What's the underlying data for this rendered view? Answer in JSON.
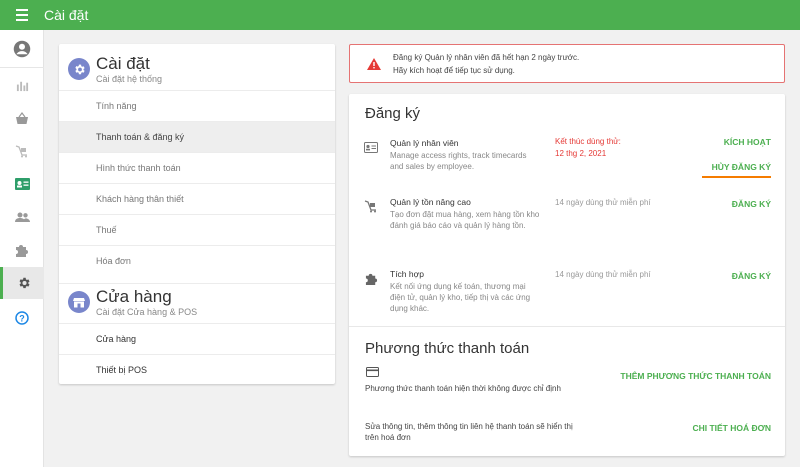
{
  "topbar": {
    "title": "Cài đặt"
  },
  "rail": {
    "items": [
      {
        "icon": "account-circle-icon"
      },
      {
        "icon": "bar-chart-icon"
      },
      {
        "icon": "basket-icon"
      },
      {
        "icon": "cart-icon"
      },
      {
        "icon": "id-card-icon"
      },
      {
        "icon": "people-icon"
      },
      {
        "icon": "puzzle-icon"
      },
      {
        "icon": "gear-icon"
      },
      {
        "icon": "help-icon"
      }
    ]
  },
  "nav": {
    "settings": {
      "title": "Cài đặt",
      "subtitle": "Cài đặt hệ thống",
      "items": [
        "Tính năng",
        "Thanh toán & đăng ký",
        "Hình thức thanh toán",
        "Khách hàng thân thiết",
        "Thuế",
        "Hóa đơn"
      ]
    },
    "store": {
      "title": "Cửa hàng",
      "subtitle": "Cài đặt Cửa hàng & POS",
      "items": [
        "Cửa hàng",
        "Thiết bị POS"
      ]
    }
  },
  "alert": {
    "line1": "Đăng ký Quản lý nhân viên đã hết hạn 2 ngày trước.",
    "line2": "Hãy kích hoạt để tiếp tục sử dụng."
  },
  "subscriptions": {
    "title": "Đăng ký",
    "rows": [
      {
        "name": "Quản lý nhân viên",
        "desc": "Manage access rights, track timecards and sales by employee.",
        "status_label": "Kết thúc dùng thử:",
        "status_date": "12 thg 2, 2021",
        "action": "KÍCH HOẠT",
        "action2": "HỦY ĐĂNG KÝ"
      },
      {
        "name": "Quản lý tồn nâng cao",
        "desc": "Tạo đơn đặt mua hàng, xem hàng tồn kho đánh giá báo cáo và quản lý hàng tồn.",
        "status": "14 ngày dùng thử miễn phí",
        "action": "ĐĂNG KÝ"
      },
      {
        "name": "Tích hợp",
        "desc": "Kết nối ứng dụng kế toán, thương mại điện tử, quản lý kho, tiếp thị và các ứng dụng khác.",
        "status": "14 ngày dùng thử miễn phí",
        "action": "ĐĂNG KÝ"
      }
    ]
  },
  "payment": {
    "title": "Phương thức thanh toán",
    "no_method": "Phương thức thanh toán hiện thời không được chỉ định",
    "add_action": "THÊM PHƯƠNG THỨC THANH TOÁN",
    "invoice_text": "Sửa thông tin, thêm thông tin liên hệ thanh toán sẽ hiển thị trên hoá đơn",
    "invoice_action": "CHI TIẾT HOÁ ĐƠN"
  },
  "colors": {
    "brand": "#4caf50",
    "danger": "#e53935",
    "accent_underline": "#f57c00",
    "section_icon": "#7986cb"
  }
}
